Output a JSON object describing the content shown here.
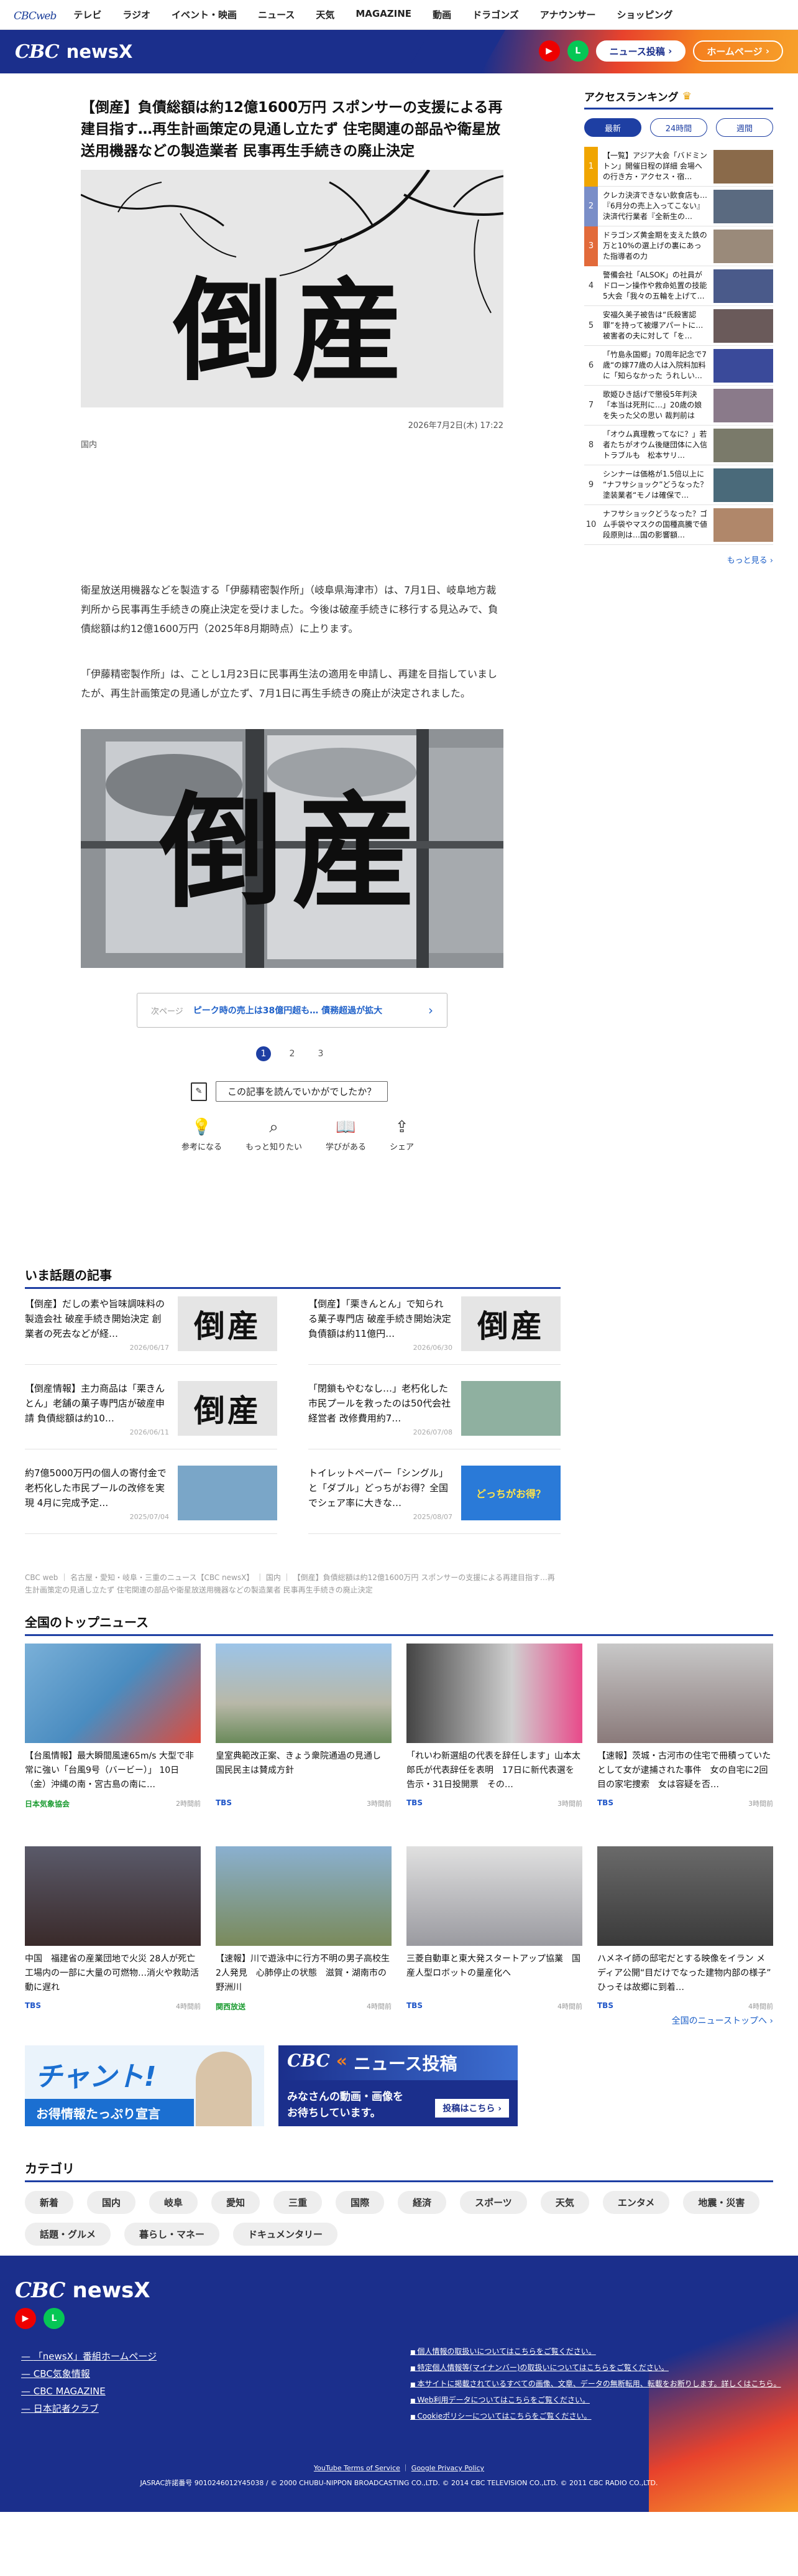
{
  "topbar": {
    "logo_main": "CBC",
    "logo_sub": "web",
    "nav": [
      "テレビ",
      "ラジオ",
      "イベント・映画",
      "ニュース",
      "天気",
      "MAGAZINE",
      "動画",
      "ドラゴンズ",
      "アナウンサー",
      "ショッピング"
    ]
  },
  "brand": {
    "logo_cbc": "CBC",
    "logo_news": "newsX",
    "post_label": "ニュース投稿",
    "home_label": "ホームページ"
  },
  "article": {
    "title": "【倒産】負債総額は約12億1600万円 スポンサーの支援による再建目指す…再生計画策定の見通し立たず 住宅関連の部品や衛星放送用機器などの製造業者 民事再生手続きの廃止決定",
    "hero_text": "倒産",
    "date": "2026年7月2日(木) 17:22",
    "category": "国内",
    "paragraph1": "衛星放送用機器などを製造する「伊藤精密製作所」（岐阜県海津市）は、7月1日、岐阜地方裁判所から民事再生手続きの廃止決定を受けました。今後は破産手続きに移行する見込みで、負債総額は約12億1600万円（2025年8月期時点）に上ります。",
    "paragraph2": "「伊藤精密製作所」は、ことし1月23日に民事再生法の適用を申請し、再建を目指していましたが、再生計画策定の見通しが立たず、7月1日に再生手続きの廃止が決定されました。",
    "hero2_text": "倒産",
    "next_label": "次ページ",
    "next_title": "ピーク時の売上は38億円超も… 債務超過が拡大",
    "pages": [
      "1",
      "2",
      "3"
    ],
    "survey_question": "この記事を読んでいかがでしたか？",
    "reactions": [
      {
        "icon": "bulb-icon",
        "glyph": "💡",
        "label": "参考になる"
      },
      {
        "icon": "search-icon",
        "glyph": "⌕",
        "label": "もっと知りたい"
      },
      {
        "icon": "book-icon",
        "glyph": "📖",
        "label": "学びがある"
      },
      {
        "icon": "share-icon",
        "glyph": "⇪",
        "label": "シェア"
      }
    ]
  },
  "topics": {
    "title": "いま話題の記事",
    "items": [
      {
        "title": "【倒産】だしの素や旨味調味料の製造会社 破産手続き開始決定 創業者の死去などが経…",
        "date": "2026/06/17",
        "thumb": "倒産"
      },
      {
        "title": "【倒産】「栗きんとん」で知られる菓子専門店 破産手続き開始決定 負債額は約11億円…",
        "date": "2026/06/30",
        "thumb": "倒産"
      },
      {
        "title": "【倒産情報】主力商品は「栗きんとん」老舗の菓子専門店が破産申請 負債総額は約10…",
        "date": "2026/06/11",
        "thumb": "倒産"
      },
      {
        "title": "「閉鎖もやむなし…」老朽化した市民プールを救ったのは50代会社経営者 改修費用約7…",
        "date": "2026/07/08",
        "thumb": ""
      },
      {
        "title": "約7億5000万円の個人の寄付金で老朽化した市民プールの改修を実現 4月に完成予定…",
        "date": "2025/07/04",
        "thumb": ""
      },
      {
        "title": "トイレットペーパー「シングル」と「ダブル」どっちがお得？全国でシェア率に大きな…",
        "date": "2025/08/07",
        "thumb": "どっちがお得？"
      }
    ]
  },
  "breadcrumb": "CBC web ｜ 名古屋・愛知・岐阜・三重のニュース【CBC newsX】 ｜ 国内 ｜ 【倒産】負債総額は約12億1600万円 スポンサーの支援による再建目指す…再生計画策定の見通し立たず 住宅関連の部品や衛星放送用機器などの製造業者 民事再生手続きの廃止決定",
  "top_news": {
    "title": "全国のトップニュース",
    "items": [
      {
        "title": "【台風情報】最大瞬間風速65m/s 大型で非常に強い「台風9号（バービー）」 10日（金）沖縄の南・宮古島の南に…",
        "source": "日本気象協会",
        "ago": "2時間前",
        "green": true
      },
      {
        "title": "皇室典範改正案、きょう衆院通過の見通し　国民民主は賛成方針",
        "source": "TBS",
        "ago": "3時間前",
        "green": false
      },
      {
        "title": "「れいわ新選組の代表を辞任します」山本太郎氏が代表辞任を表明　17日に新代表選を告示・31日投開票　その…",
        "source": "TBS",
        "ago": "3時間前",
        "green": false
      },
      {
        "title": "【速報】茨城・古河市の住宅で冊積っていたとして女が逮捕された事件　女の自宅に2回目の家宅捜索　女は容疑を否…",
        "source": "TBS",
        "ago": "3時間前",
        "green": false
      },
      {
        "title": "中国　福建省の産業団地で火災 28人が死亡　工場内の一部に大量の可燃物…消火や救助活動に遅れ",
        "source": "TBS",
        "ago": "4時間前",
        "green": false
      },
      {
        "title": "【速報】川で遊泳中に行方不明の男子高校生2人発見　心肺停止の状態　滋賀・湖南市の野洲川",
        "source": "関西放送",
        "ago": "4時間前",
        "green": true
      },
      {
        "title": "三菱自動車と東大発スタートアップ協業　国産人型ロボットの量産化へ",
        "source": "TBS",
        "ago": "4時間前",
        "green": false
      },
      {
        "title": "ハメネイ師の邸宅だとする映像をイラン メディア公開“目だけでなった建物内部の様子” ひっそは故郷に到着…",
        "source": "TBS",
        "ago": "4時間前",
        "green": false
      }
    ],
    "more": "全国のニューストップへ ›"
  },
  "banners": {
    "chant_title": "チャント!",
    "chant_sub": "お得情報たっぷり宣言",
    "post_logo": "CBC",
    "post_title": "ニュース投稿",
    "post_sub1": "みなさんの動画・画像を",
    "post_sub2": "お待ちしています。",
    "post_cta": "投稿はこちら ›"
  },
  "categories": {
    "title": "カテゴリ",
    "items": [
      "新着",
      "国内",
      "岐阜",
      "愛知",
      "三重",
      "国際",
      "経済",
      "スポーツ",
      "天気",
      "エンタメ",
      "地震・災害",
      "話題・グルメ",
      "暮らし・マネー",
      "ドキュメンタリー"
    ]
  },
  "sidebar": {
    "title": "アクセスランキング",
    "tabs": [
      "最新",
      "24時間",
      "週間"
    ],
    "items": [
      {
        "rank": "1",
        "title": "【一覧】アジア大会「バドミントン」開催日程の詳細 会場への行き方・アクセス・宿…"
      },
      {
        "rank": "2",
        "title": "クレカ決済できない飲食店も…『6月分の売上入ってこない』決済代行業者『全新生の…"
      },
      {
        "rank": "3",
        "title": "ドラゴンズ黄金期を支えた鉄の万と10%の選上げの裏にあった指導者の力"
      },
      {
        "rank": "4",
        "title": "警備会社「ALSOK」の社員がドローン操作や救命処置の技能5大会「我々の五輪を上げて…"
      },
      {
        "rank": "5",
        "title": "安福久美子被告は“氏殺害認罪”を持って被爆アパートに…被害者の夫に対して「を…"
      },
      {
        "rank": "6",
        "title": "「竹島永国郷」70周年記念で7歳“の嫁77歳の人は入院料加料に「知らなかった うれしい…"
      },
      {
        "rank": "7",
        "title": "歌姫ひき話げで懲役5年判決「本当は死刑に…」20歳の娘を失った父の思い 裁判前は被…"
      },
      {
        "rank": "8",
        "title": "「オウム真理教ってなに？」若者たちがオウム後継団体に入信 トラブルも　松本サリ…"
      },
      {
        "rank": "9",
        "title": "シンナーは価格が1.5倍以上に “ナフサショック”どうなった？ 塗装業者“モノは確保で…"
      },
      {
        "rank": "10",
        "title": "ナフサショックどうなった？ゴム手袋やマスクの国種高騰で値段原則は…国の影響額…"
      }
    ],
    "more": "もっと見る ›"
  },
  "footer": {
    "logo_cbc": "CBC",
    "logo_news": "newsX",
    "links": [
      "「newsX」番組ホームページ",
      "CBC気象情報",
      "CBC MAGAZINE",
      "日本記者クラブ"
    ],
    "notices": [
      "個人情報の取扱いについてはこちらをご覧ください。",
      "特定個人情報等(マイナンバー)の取扱いについてはこちらをご覧ください。",
      "本サイトに掲載されているすべての画像、文章、データの無断転用、転載をお断りします。詳しくはこちら。",
      "Web利用データについてはこちらをご覧ください。",
      "Cookieポリシーについてはこちらをご覧ください。"
    ],
    "policy1": "YouTube Terms of Service",
    "policy2": "Google Privacy Policy",
    "copyright": "JASRAC許諾番号 9010246012Y45038 / © 2000 CHUBU-NIPPON BROADCASTING CO.,LTD. © 2014 CBC TELEVISION CO.,LTD. © 2011 CBC RADIO CO.,LTD."
  }
}
